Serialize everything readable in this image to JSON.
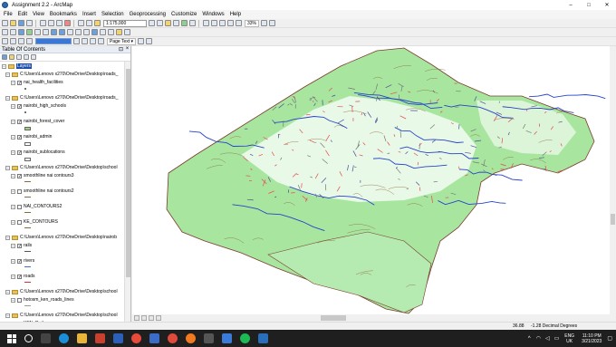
{
  "window": {
    "title": "Assignment 2.2 - ArcMap",
    "minimize": "–",
    "maximize": "□",
    "close": "✕"
  },
  "menu": [
    "File",
    "Edit",
    "View",
    "Bookmarks",
    "Insert",
    "Selection",
    "Geoprocessing",
    "Customize",
    "Windows",
    "Help"
  ],
  "toolbar": {
    "scale": "1:175,000",
    "zoom_percent": "33%",
    "page_text": "Page Text ▾"
  },
  "toc": {
    "title": "Table Of Contents",
    "root": "Layers",
    "rows": [
      {
        "kind": "folder",
        "label": "C:\\Users\\Lenovo x270\\OneDrive\\Desktop\\roads_"
      },
      {
        "kind": "layer",
        "label": "nai_health_facilities",
        "checked": true,
        "symbol": "point"
      },
      {
        "kind": "folder",
        "label": "C:\\Users\\Lenovo x270\\OneDrive\\Desktop\\roads_"
      },
      {
        "kind": "layer",
        "label": "nairobi_high_schools",
        "checked": true,
        "symbol": "point"
      },
      {
        "kind": "layer",
        "label": "nairobi_forest_cover",
        "checked": true,
        "symbol": "poly",
        "color": "#9bd37a"
      },
      {
        "kind": "layer",
        "label": "nairobi_admin",
        "checked": true,
        "symbol": "poly",
        "color": "#ffffff"
      },
      {
        "kind": "layer",
        "label": "nairobi_sublocations",
        "checked": true,
        "symbol": "poly",
        "color": "#ffffff"
      },
      {
        "kind": "folder",
        "label": "C:\\Users\\Lenovo x270\\OneDrive\\Desktop\\school"
      },
      {
        "kind": "layer",
        "label": "smoothline nai contours3",
        "checked": true,
        "symbol": "line",
        "color": "#8a6a3a"
      },
      {
        "kind": "layer",
        "label": "smoothline nai contours2",
        "checked": false,
        "symbol": "line",
        "color": "#8a6a3a"
      },
      {
        "kind": "layer",
        "label": "NAI_CONTOURS2",
        "checked": false,
        "symbol": "line",
        "color": "#8a6a3a"
      },
      {
        "kind": "layer",
        "label": "KE_CONTOURS",
        "checked": false,
        "symbol": "line",
        "color": "#8a6a3a"
      },
      {
        "kind": "folder",
        "label": "C:\\Users\\Lenovo x270\\OneDrive\\Desktop\\nairob"
      },
      {
        "kind": "layer",
        "label": "rails",
        "checked": true,
        "symbol": "line",
        "color": "#555555"
      },
      {
        "kind": "layer",
        "label": "rivers",
        "checked": true,
        "symbol": "line",
        "color": "#3a6fd8"
      },
      {
        "kind": "layer",
        "label": "roads",
        "checked": true,
        "symbol": "line",
        "color": "#cc3333"
      },
      {
        "kind": "folder",
        "label": "C:\\Users\\Lenovo x270\\OneDrive\\Desktop\\school"
      },
      {
        "kind": "layer",
        "label": "hotosm_ken_roads_lines",
        "checked": false,
        "symbol": "line",
        "color": "#999999"
      },
      {
        "kind": "folder",
        "label": "C:\\Users\\Lenovo x270\\OneDrive\\Desktop\\school"
      },
      {
        "kind": "layer",
        "label": "KEN_Rails",
        "checked": false,
        "symbol": "none"
      }
    ]
  },
  "map": {
    "forest_color": "#a8e6a0",
    "road_color": "#e8484f",
    "river_color": "#2643c8",
    "outline_color": "#7a3b2e"
  },
  "status": {
    "coords": "36.88",
    "units": "-1.28 Decimal Degrees"
  },
  "taskbar": {
    "lang_top": "ENG",
    "lang_bottom": "UK",
    "time": "11:10 PM",
    "date": "3/21/2023"
  }
}
